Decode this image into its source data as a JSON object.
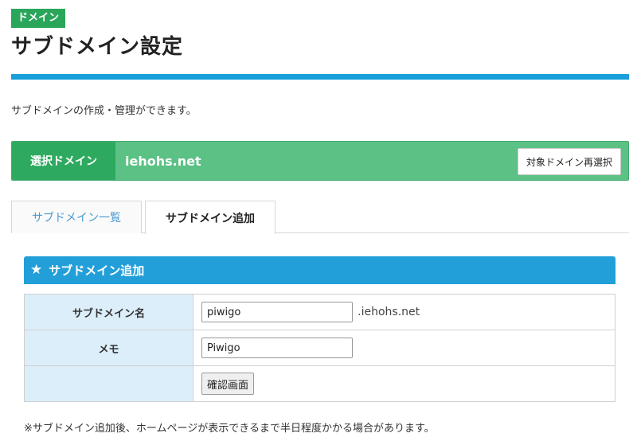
{
  "header": {
    "badge": "ドメイン",
    "title": "サブドメイン設定",
    "description": "サブドメインの作成・管理ができます。"
  },
  "domain_bar": {
    "label": "選択ドメイン",
    "domain": "iehohs.net",
    "reselect_label": "対象ドメイン再選択"
  },
  "tabs": [
    {
      "label": "サブドメイン一覧",
      "active": false
    },
    {
      "label": "サブドメイン追加",
      "active": true
    }
  ],
  "section": {
    "icon": "star-icon",
    "title": "サブドメイン追加"
  },
  "form": {
    "subdomain_label": "サブドメイン名",
    "subdomain_value": "piwigo",
    "subdomain_suffix": ".iehohs.net",
    "memo_label": "メモ",
    "memo_value": "Piwigo",
    "confirm_label": "確認画面"
  },
  "note": "※サブドメイン追加後、ホームページが表示できるまで半日程度かかる場合があります。",
  "colors": {
    "badge_green": "#2aa65a",
    "domain_bar_green": "#5bc185",
    "accent_blue": "#199fda",
    "label_cell_bg": "#dceefa"
  }
}
